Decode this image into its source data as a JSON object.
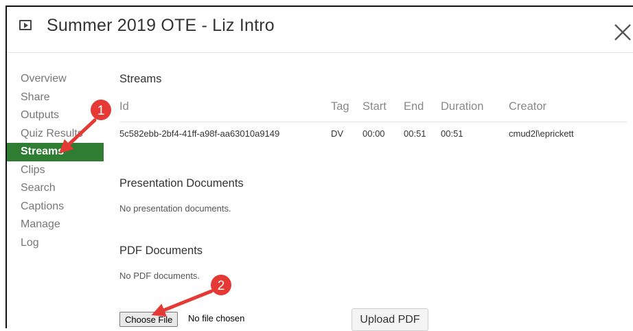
{
  "header": {
    "title": "Summer 2019 OTE - Liz Intro"
  },
  "sidebar": {
    "items": [
      {
        "label": "Overview"
      },
      {
        "label": "Share"
      },
      {
        "label": "Outputs"
      },
      {
        "label": "Quiz Results"
      },
      {
        "label": "Streams",
        "active": true
      },
      {
        "label": "Clips"
      },
      {
        "label": "Search"
      },
      {
        "label": "Captions"
      },
      {
        "label": "Manage"
      },
      {
        "label": "Log"
      }
    ]
  },
  "streams": {
    "title": "Streams",
    "columns": [
      "Id",
      "Tag",
      "Start",
      "End",
      "Duration",
      "Creator"
    ],
    "rows": [
      [
        "5c582ebb-2bf4-41ff-a98f-aa63010a9149",
        "DV",
        "00:00",
        "00:51",
        "00:51",
        "cmud2l\\eprickett"
      ]
    ]
  },
  "presentation": {
    "title": "Presentation Documents",
    "empty_text": "No presentation documents."
  },
  "pdf": {
    "title": "PDF Documents",
    "empty_text": "No PDF documents.",
    "choose_file_label": "Choose File",
    "no_file_text": "No file chosen",
    "upload_label": "Upload PDF"
  },
  "annotations": {
    "badge_1": "1",
    "badge_2": "2"
  },
  "colors": {
    "active_nav": "#2e7d32",
    "annotation_red": "#e53935"
  },
  "icons": {
    "title_icon": "play-icon",
    "close": "close-icon"
  }
}
